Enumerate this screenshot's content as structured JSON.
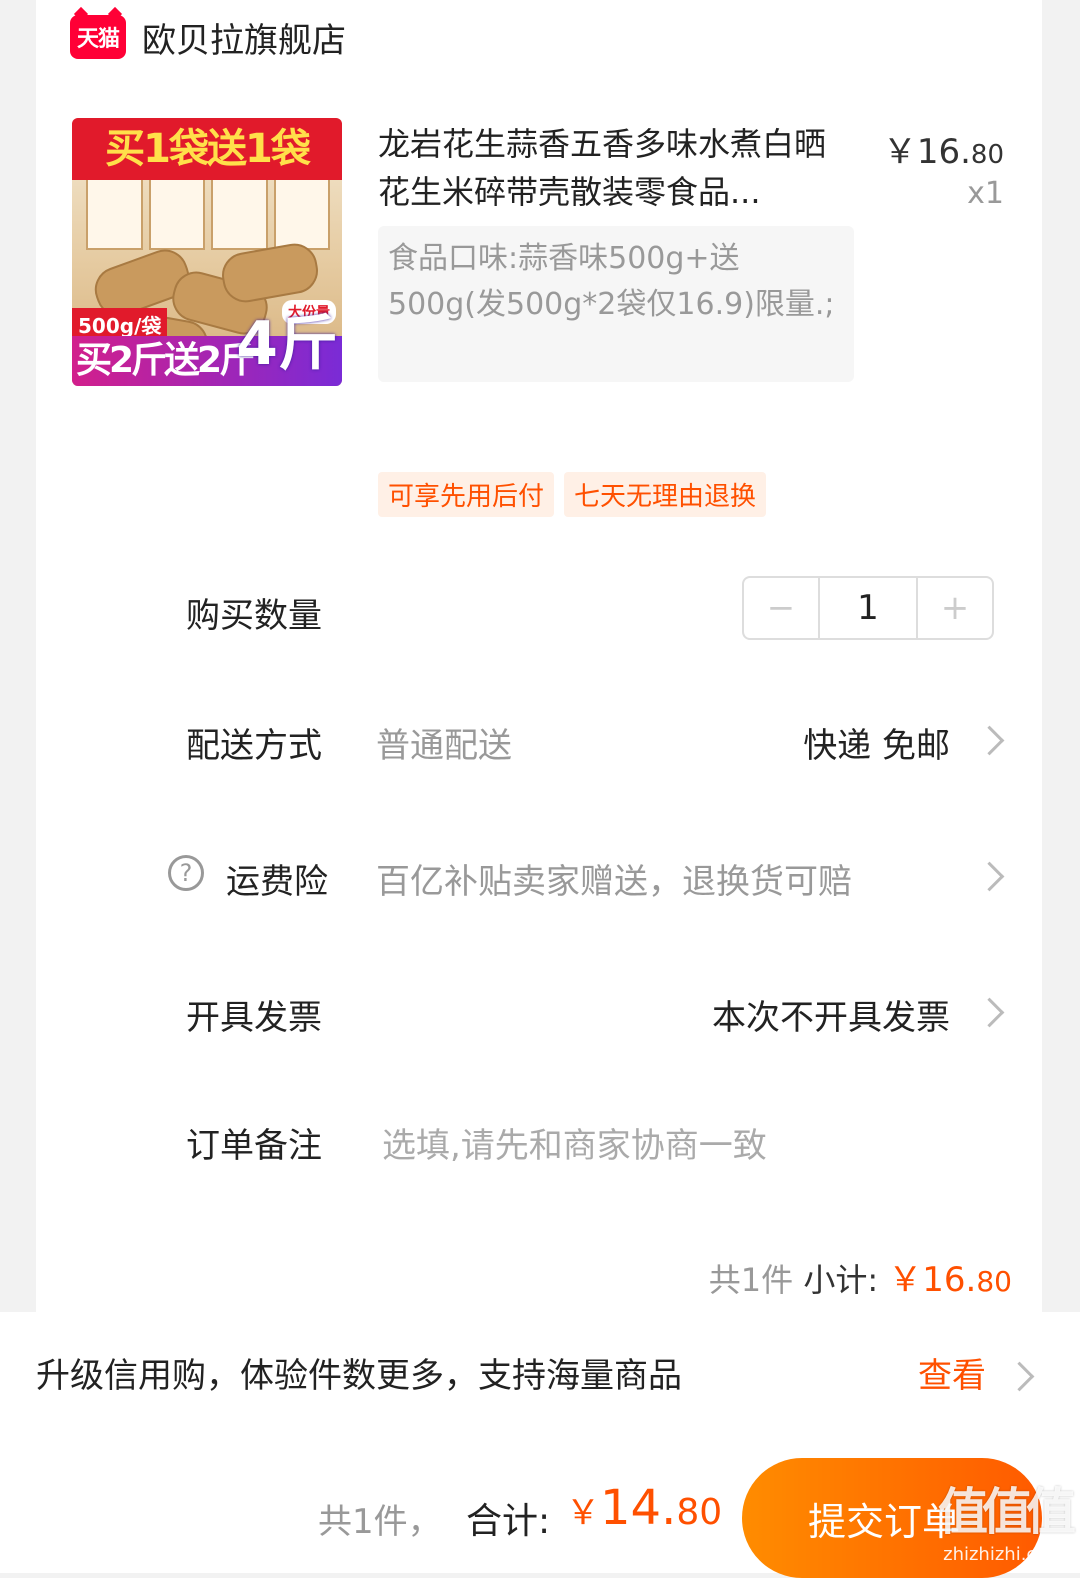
{
  "store": {
    "logo_text": "天猫",
    "name": "欧贝拉旗舰店"
  },
  "product": {
    "image_banner": "买1袋送1袋",
    "image_weight": "500g/袋",
    "image_tag": "大份量",
    "image_bottom": "买2斤送2斤",
    "image_big": "4斤",
    "title": "龙岩花生蒜香五香多味水煮白晒花生米碎带壳散装零食品...",
    "price_main": "￥16.",
    "price_decimal": "80",
    "quantity_label": "x1",
    "sku": "食品口味:蒜香味500g+送500g(发500g*2袋仅16.9)限量.;"
  },
  "tags": [
    "可享先用后付",
    "七天无理由退换"
  ],
  "rows": {
    "quantity": {
      "label": "购买数量",
      "minus": "−",
      "value": "1",
      "plus": "+"
    },
    "delivery": {
      "label": "配送方式",
      "value": "普通配送",
      "right": "快递 免邮"
    },
    "insurance": {
      "icon": "?",
      "label": "运费险",
      "value": "百亿补贴卖家赠送，退换货可赔"
    },
    "invoice": {
      "label": "开具发票",
      "right": "本次不开具发票"
    },
    "note": {
      "label": "订单备注",
      "placeholder": "选填,请先和商家协商一致"
    }
  },
  "subtotal": {
    "count": "共1件",
    "label": "小计:",
    "amount_main": "￥16.",
    "amount_decimal": "80"
  },
  "credit": {
    "text": "升级信用购，体验件数更多，支持海量商品",
    "link": "查看"
  },
  "bottom": {
    "count": "共1件，",
    "total_label": "合计:",
    "total_yen": "￥",
    "total_main": "14.",
    "total_decimal": "80",
    "submit_label": "提交订单"
  },
  "watermark": {
    "logo": "值值值",
    "url": "zhizhizhi.com"
  },
  "colors": {
    "accent": "#ff5000",
    "tmall_red": "#ff0036",
    "button_start": "#ff8c00",
    "button_end": "#ff5a00"
  }
}
